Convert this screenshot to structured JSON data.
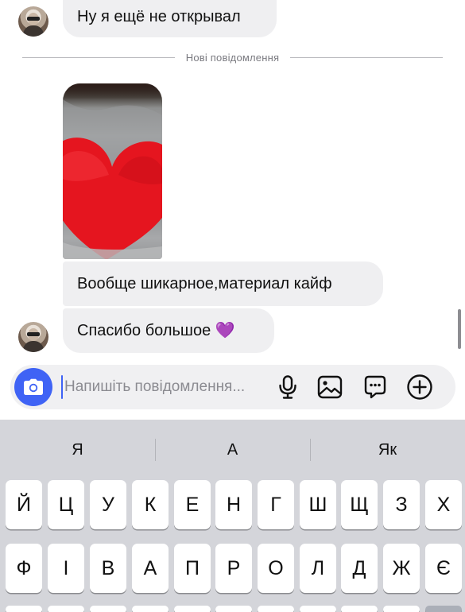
{
  "messages": [
    {
      "text": "Ну я ещё не открывал",
      "side": "incoming"
    },
    {
      "text": "Вообще шикарное,материал кайф",
      "side": "incoming"
    },
    {
      "text": "Спасибо большое 💜",
      "side": "incoming"
    }
  ],
  "divider_label": "Нові повідомлення",
  "composer": {
    "placeholder": "Напишіть повідомлення...",
    "icons": [
      "camera-icon",
      "microphone-icon",
      "gallery-icon",
      "sticker-chat-icon",
      "plus-circle-icon"
    ],
    "accent": "#3f63f5"
  },
  "keyboard": {
    "suggestions": [
      "Я",
      "А",
      "Як"
    ],
    "row1": [
      "Й",
      "Ц",
      "У",
      "К",
      "Е",
      "Н",
      "Г",
      "Ш",
      "Щ",
      "З",
      "Х"
    ],
    "row2": [
      "Ф",
      "І",
      "В",
      "А",
      "П",
      "Р",
      "О",
      "Л",
      "Д",
      "Ж",
      "Є"
    ]
  }
}
